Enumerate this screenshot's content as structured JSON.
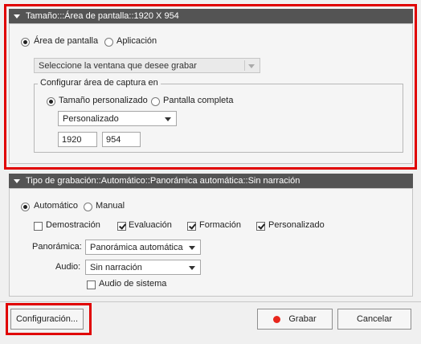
{
  "screen_panel": {
    "title": "Tamaño:::Área de pantalla::1920 X 954",
    "mode_options": [
      {
        "label": "Área de pantalla",
        "selected": true
      },
      {
        "label": "Aplicación",
        "selected": false
      }
    ],
    "window_select": {
      "value": "Seleccione la ventana que desee grabar",
      "enabled": false
    },
    "capture_group": {
      "legend": "Configurar área de captura en",
      "size_options": [
        {
          "label": "Tamaño personalizado",
          "selected": true
        },
        {
          "label": "Pantalla completa",
          "selected": false
        }
      ],
      "preset_select": {
        "value": "Personalizado"
      },
      "width": "1920",
      "height": "954"
    }
  },
  "recording_panel": {
    "title": "Tipo de grabación::Automático::Panorámica automática::Sin narración",
    "mode_options": [
      {
        "label": "Automático",
        "selected": true
      },
      {
        "label": "Manual",
        "selected": false
      }
    ],
    "type_checks": [
      {
        "label": "Demostración",
        "checked": false
      },
      {
        "label": "Evaluación",
        "checked": true
      },
      {
        "label": "Formación",
        "checked": true
      },
      {
        "label": "Personalizado",
        "checked": true
      }
    ],
    "panning": {
      "label": "Panorámica:",
      "value": "Panorámica automática"
    },
    "audio": {
      "label": "Audio:",
      "value": "Sin narración"
    },
    "system_audio": {
      "label": "Audio de sistema",
      "checked": false
    }
  },
  "footer": {
    "settings_label": "Configuración...",
    "record_label": "Grabar",
    "cancel_label": "Cancelar"
  },
  "colors": {
    "highlight": "#e00000",
    "record_dot": "#e8261c",
    "header_bg": "#545454"
  }
}
